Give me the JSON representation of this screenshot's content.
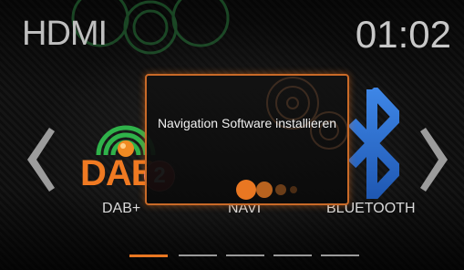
{
  "header": {
    "source": "HDMI",
    "clock": "01:02"
  },
  "tiles": [
    {
      "label": "DAB+",
      "icon": "dab-radio-icon",
      "logo_text": "DAB",
      "badge": "2"
    },
    {
      "label": "NAVI",
      "icon": "navigation-icon"
    },
    {
      "label": "BLUETOOTH",
      "icon": "bluetooth-icon"
    }
  ],
  "popup": {
    "message": "Navigation Software installieren",
    "progress_icon": "loading-dots-icon"
  },
  "pager": {
    "pages": 5,
    "active_index": 0
  },
  "colors": {
    "accent": "#e97722",
    "badge": "#d3262b",
    "bluetooth": "#2f6ecf",
    "dab_green": "#2fb24a"
  }
}
